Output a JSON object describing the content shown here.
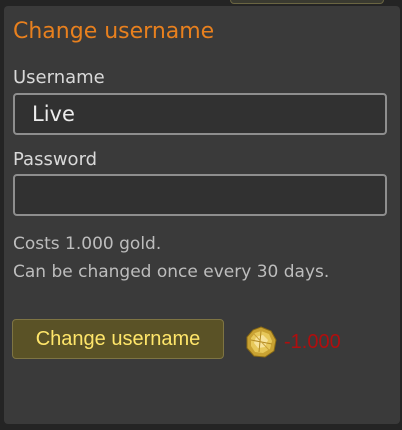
{
  "panel": {
    "title": "Change username",
    "username_label": "Username",
    "username_value": "Live",
    "password_label": "Password",
    "password_value": "",
    "info_line1": "Costs 1.000 gold.",
    "info_line2": "Can be changed once every 30 days.",
    "button_label": "Change username",
    "cost_icon": "gold-coin-icon",
    "cost_value": "-1.000"
  },
  "colors": {
    "title": "#e8801e",
    "button_bg": "#5a5226",
    "button_text": "#ffe66a",
    "cost_text": "#b00e0e"
  }
}
